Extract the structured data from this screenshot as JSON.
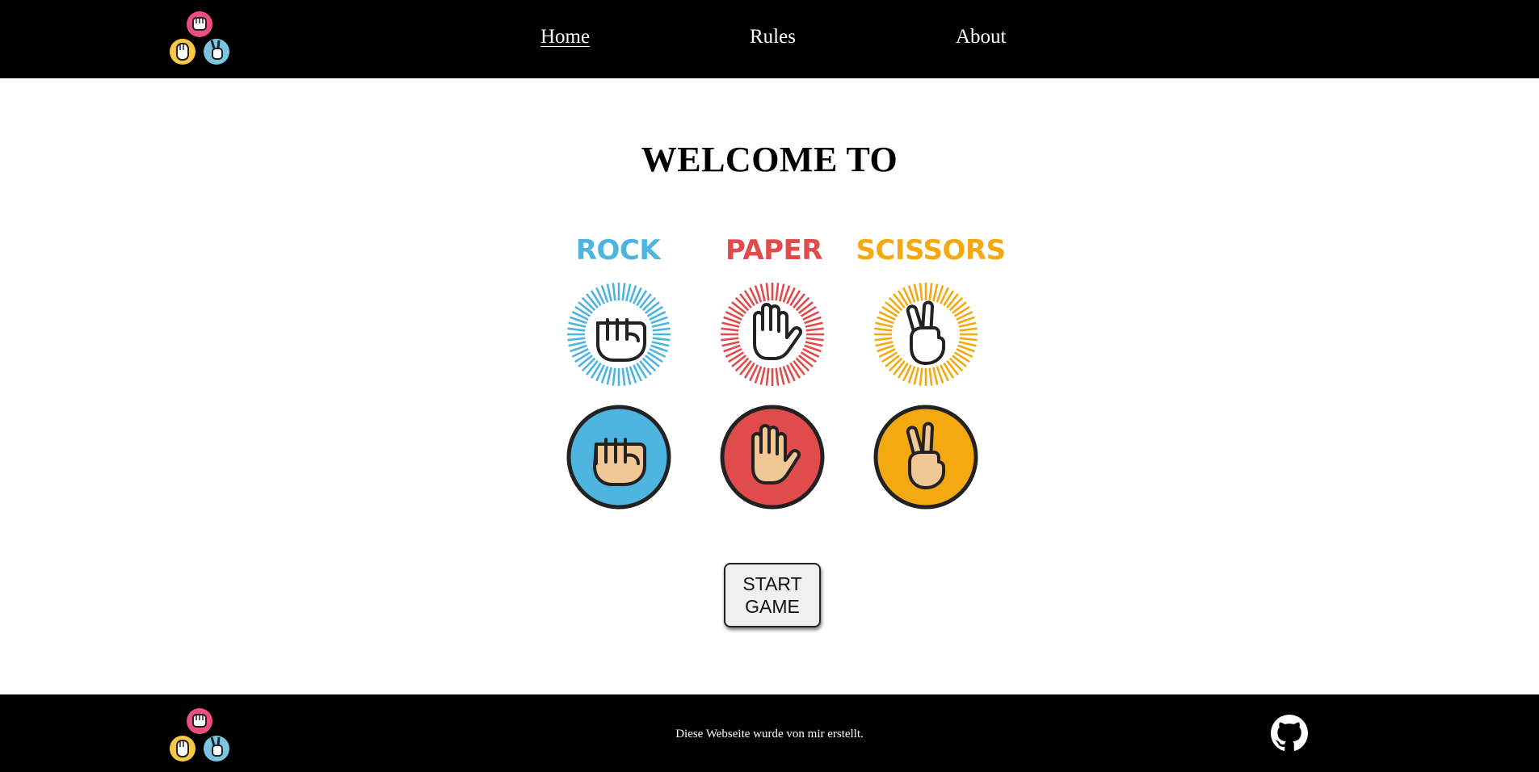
{
  "nav": {
    "items": [
      {
        "label": "Home",
        "active": true
      },
      {
        "label": "Rules",
        "active": false
      },
      {
        "label": "About",
        "active": false
      }
    ]
  },
  "main": {
    "heading": "WELCOME TO",
    "words": [
      {
        "text": "ROCK",
        "color": "#4eb4e0"
      },
      {
        "text": "PAPER",
        "color": "#e04b4b"
      },
      {
        "text": "SCISSORS",
        "color": "#f5a911"
      }
    ],
    "start_button": "START\nGAME"
  },
  "footer": {
    "text": "Diese Webseite wurde von mir erstellt."
  },
  "icons": {
    "logo": "rock-paper-scissors-logo-icon",
    "rock": "rock-fist-icon",
    "paper": "paper-hand-icon",
    "scissors": "scissors-hand-icon",
    "github": "github-icon"
  },
  "colors": {
    "header_bg": "#000000",
    "footer_bg": "#000000",
    "rock_blue": "#4eb4e0",
    "paper_red": "#e04b4b",
    "scissors_yellow": "#f5a911",
    "skin": "#f1c796",
    "logo_pink": "#ec4f7f",
    "logo_yellow": "#f9c844",
    "logo_lightblue": "#7ac6e1"
  }
}
